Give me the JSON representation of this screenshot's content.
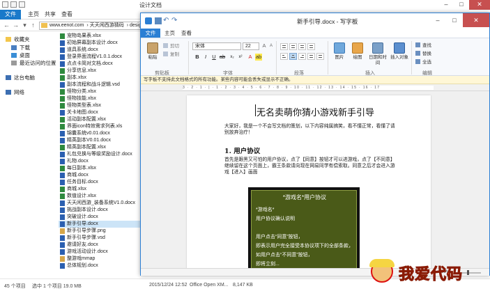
{
  "explorer": {
    "title": "设计文档",
    "tabs": [
      "文件",
      "主页",
      "共享",
      "查看"
    ],
    "address": [
      "www.eenot.com",
      "天天闲西游猜码",
      "desig"
    ],
    "nav": {
      "favorites": "收藏夹",
      "favorites_items": [
        "下载",
        "桌面",
        "最近访问的位置"
      ],
      "computer": "这台电脑",
      "network": "网络"
    },
    "files": [
      {
        "name": "宠物岛果表.xlsx",
        "t": "x"
      },
      {
        "name": "初始屏幕副本设计.docx",
        "t": "d"
      },
      {
        "name": "道具系统.docx",
        "t": "d"
      },
      {
        "name": "登录界面流程V1.0.1.docx",
        "t": "d"
      },
      {
        "name": "点点卡简对文档.docx",
        "t": "d"
      },
      {
        "name": "分享信息.xlsx",
        "t": "x"
      },
      {
        "name": "副本.xlsx",
        "t": "x"
      },
      {
        "name": "副本流程和战斗逻辑.vsd",
        "t": "d"
      },
      {
        "name": "怪物分类.xlsx",
        "t": "x"
      },
      {
        "name": "怪物技能.xlsx",
        "t": "x"
      },
      {
        "name": "怪物类型表.xlsx",
        "t": "x"
      },
      {
        "name": "关卡地图.docx",
        "t": "d"
      },
      {
        "name": "活动副本配置.xlsx",
        "t": "x"
      },
      {
        "name": "界面icon特效需求列表.xls",
        "t": "x"
      },
      {
        "name": "锦囊系统v0.01.docx",
        "t": "d"
      },
      {
        "name": "精英副本V0.01.docx",
        "t": "d"
      },
      {
        "name": "精英副本配置.xlsx",
        "t": "x"
      },
      {
        "name": "礼包兑换与等级奖励设计.docx",
        "t": "d"
      },
      {
        "name": "礼物.docx",
        "t": "d"
      },
      {
        "name": "每日副本.xlsx",
        "t": "x"
      },
      {
        "name": "商城.docx",
        "t": "d"
      },
      {
        "name": "任务目标.docx",
        "t": "d"
      },
      {
        "name": "商城.xlsx",
        "t": "x"
      },
      {
        "name": "数值设计.xlsx",
        "t": "x"
      },
      {
        "name": "天天闲西游_装备系统V1.0.docx",
        "t": "d"
      },
      {
        "name": "挑战副本设计.docx",
        "t": "d"
      },
      {
        "name": "突破设计.docx",
        "t": "d"
      },
      {
        "name": "新手引导.docx",
        "t": "d",
        "sel": true
      },
      {
        "name": "新手引导步骤.png",
        "t": "i"
      },
      {
        "name": "新手引导步骤.vsd",
        "t": "d"
      },
      {
        "name": "邀请好友.docx",
        "t": "d"
      },
      {
        "name": "游戏活动设计.docx",
        "t": "d"
      },
      {
        "name": "整游戏mmap",
        "t": "i"
      },
      {
        "name": "总体规划.docx",
        "t": "d"
      }
    ],
    "status": {
      "count": "45 个项目",
      "selected": "选中 1 个项目  19.0 MB",
      "date": "2015/12/24 12:52",
      "type": "Office Open XM...",
      "size": "8,147 KB"
    }
  },
  "wordpad": {
    "title": "新手引导.docx - 写字板",
    "tabs": [
      "文件",
      "主页",
      "查看"
    ],
    "ribbon": {
      "paste": "粘贴",
      "cut": "剪切",
      "copy": "复制",
      "clipboard": "剪贴板",
      "font_name": "宋体",
      "font_size": "22",
      "font": "字体",
      "paragraph": "段落",
      "picture": "图片",
      "paint": "绘图",
      "datetime": "日期和时间",
      "insert_object": "插入对象",
      "insert": "插入",
      "find": "查找",
      "replace": "替换",
      "select_all": "全选",
      "editing": "编辑"
    },
    "info_bar": "写字板不支持此文档格式的所有功能。某些内容可能会丢失或显示不正确。",
    "ruler_marks": "3 · 2 · 1 · | · 1 · 2 · 3 · 4 · 5 · 6 · 7 · 8 · 9 · 10 · 11 · 12 · 13 · 14 · 15 · 16 · 17",
    "zoom": "100%",
    "zoom_level": 0.5,
    "document": {
      "title": "无名卖萌你猜小游戏新手引导",
      "intro": "大家好，我是一个不会写文档的策划，以下内容纯属搞笑，看不懂正常，看懂了请别放弃治疗！",
      "section_heading": "1. 用户协议",
      "section_body": "首先是跟黑又可怕的用户协议，点了【同意】按钮才可以进游戏，点了【不同意】继续留在这个页面上，霸王条款请向现在网易同学有偿索取。同意之后才会进入游戏【进入】画面",
      "dialog": {
        "title": "*游戏名*用户协议",
        "lines": [
          "*游戏名*",
          "用户协议确认说明",
          "",
          "用户点击“同意”按钮，",
          "即表示用户完全接受本协议项下的全部条款，",
          "如用户点击“不同意”按钮，",
          "即将立刻..."
        ]
      }
    }
  },
  "colors": {
    "accent": "#2b7fd4",
    "close": "#c75050",
    "dialog_bg": "#4a5a18"
  }
}
